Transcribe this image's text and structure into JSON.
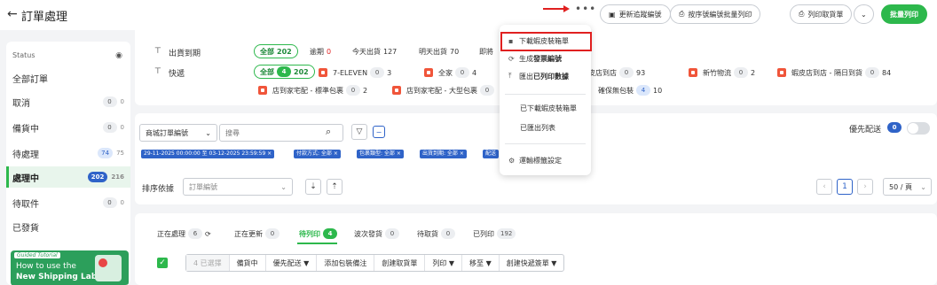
{
  "header": {
    "back_glyph": "←",
    "title": "訂單處理",
    "more_glyph": "•••",
    "btn_update_tracking": "更新追蹤編號",
    "btn_batch_print_by_number": "按序號編號批量列印",
    "btn_print_pickup": "列印取貨單",
    "btn_batch_print": "批量列印"
  },
  "sidebar": {
    "status_label": "Status",
    "items": [
      {
        "label": "全部訂單",
        "count": "",
        "sub": ""
      },
      {
        "label": "取消",
        "count": "0",
        "sub": "0"
      },
      {
        "label": "備貨中",
        "count": "0",
        "sub": "0"
      },
      {
        "label": "待處理",
        "count": "74",
        "sub": "75"
      },
      {
        "label": "處理中",
        "count": "202",
        "sub": "216"
      },
      {
        "label": "待取件",
        "count": "0",
        "sub": "0"
      },
      {
        "label": "已發貨",
        "count": "",
        "sub": ""
      }
    ],
    "tutorial": {
      "tag": "Guided Tutorial",
      "line1": "How to use the",
      "line2": "New Shipping Label?"
    }
  },
  "filters": {
    "ship_due_label": "出貨到期",
    "ship_due_chips": [
      {
        "label": "全部",
        "count": "202"
      },
      {
        "label": "逾期",
        "count": "0"
      },
      {
        "label": "今天出貨",
        "count": "127"
      },
      {
        "label": "明天出貨",
        "count": "70"
      },
      {
        "label": "即將",
        "count": ""
      }
    ],
    "express_label": "快遞",
    "express_row1": [
      {
        "label": "全部",
        "count": "4",
        "total": "202"
      },
      {
        "label": "7-ELEVEN",
        "count": "0",
        "total": "3"
      },
      {
        "label": "全家",
        "count": "0",
        "total": "4"
      },
      {
        "label": "蝦皮店到店",
        "count": "0",
        "total": "93"
      },
      {
        "label": "新竹物流",
        "count": "0",
        "total": "2"
      },
      {
        "label": "蝦皮店到店 - 隔日到貨",
        "count": "0",
        "total": "84"
      }
    ],
    "express_row2": [
      {
        "label": "店到家宅配 - 標準包裹",
        "count": "0",
        "total": "2"
      },
      {
        "label": "店到家宅配 - 大型包裹",
        "count": "0",
        "total": ""
      },
      {
        "label": "確保無包裝",
        "count": "4",
        "total": "10"
      }
    ]
  },
  "dropdown": {
    "items": [
      {
        "icon": "▪",
        "label": "下載蝦皮裝箱單",
        "bold": ""
      },
      {
        "icon": "⟳",
        "label": "生成 ",
        "bold": "發票編號"
      },
      {
        "icon": "⤒",
        "label": "匯出 ",
        "bold": "已列印數據"
      },
      {
        "icon": "",
        "label": "已下載蝦皮裝箱單",
        "bold": ""
      },
      {
        "icon": "",
        "label": "已匯出列表",
        "bold": ""
      },
      {
        "icon": "⚙",
        "label": "運輸標籤設定",
        "bold": ""
      }
    ]
  },
  "search": {
    "field_select": "商城訂單編號",
    "placeholder": "搜尋",
    "priority_label": "優先配送",
    "priority_count": "0",
    "tags": [
      "29-11-2025 00:00:00 至 03-12-2025 23:59:59 ×",
      "付款方式: 全部 ×",
      "包裹類型: 全部 ×",
      "出貨到期: 全部 ×",
      "配送"
    ]
  },
  "sort": {
    "label": "排序依據",
    "field": "訂單編號",
    "page": "1",
    "per_page": "50 / 頁"
  },
  "tabs": [
    {
      "label": "正在處理",
      "count": "6"
    },
    {
      "label": "正在更新",
      "count": "0"
    },
    {
      "label": "待列印",
      "count": "4"
    },
    {
      "label": "波次發貨",
      "count": "0"
    },
    {
      "label": "待取貨",
      "count": "0"
    },
    {
      "label": "已列印",
      "count": "192"
    }
  ],
  "actions": {
    "selected": "4 已選擇",
    "buttons": [
      "備貨中",
      "優先配送 ▼",
      "添加包裝備注",
      "創建取貨單",
      "列印 ▼",
      "移至 ▼",
      "創建快遞簽單 ▼"
    ]
  },
  "colors": {
    "accent_green": "#2db84c",
    "tag_blue": "#2f63c8",
    "highlight_red": "#e02020"
  }
}
